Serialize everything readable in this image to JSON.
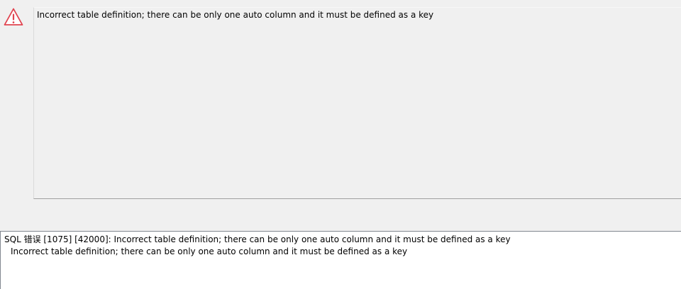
{
  "dialog": {
    "icon": "warning-triangle-icon",
    "icon_color": "#e0434f",
    "message": "Incorrect table definition; there can be only one auto column and it must be defined as a key"
  },
  "details": {
    "lines": [
      "SQL 错误 [1075] [42000]: Incorrect table definition; there can be only one auto column and it must be defined as a key",
      "Incorrect table definition; there can be only one auto column and it must be defined as a key"
    ]
  }
}
